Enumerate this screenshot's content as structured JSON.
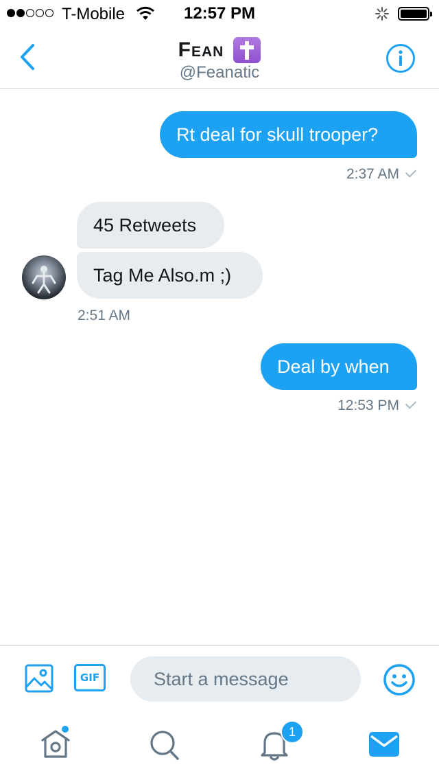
{
  "status_bar": {
    "carrier": "T-Mobile",
    "time": "12:57 PM",
    "signal_bars_filled": 2,
    "signal_bars_total": 5,
    "battery_level": 1.0,
    "icons": [
      "signal-dots-icon",
      "wifi-icon",
      "activity-spinner-icon",
      "battery-icon"
    ]
  },
  "header": {
    "name": "Fean",
    "name_emoji": "latin-cross-emoji",
    "handle": "@Feanatic",
    "icons": [
      "chevron-left-icon",
      "info-icon"
    ]
  },
  "conversation": {
    "messages": [
      {
        "direction": "outgoing",
        "text": "Rt deal for skull trooper?",
        "time": "2:37 AM",
        "read_check": true
      },
      {
        "direction": "incoming",
        "text": "45 Retweets"
      },
      {
        "direction": "incoming",
        "text": "Tag Me Also.m ;)",
        "time": "2:51 AM"
      },
      {
        "direction": "outgoing",
        "text": "Deal by when",
        "time": "12:53 PM",
        "read_check": true
      }
    ]
  },
  "composer": {
    "placeholder": "Start a message",
    "value": "",
    "gif_label": "GIF",
    "icons": [
      "image-icon",
      "gif-icon",
      "emoji-icon"
    ]
  },
  "tab_bar": {
    "tabs": [
      {
        "name": "home",
        "icon": "home-icon",
        "has_dot": true
      },
      {
        "name": "search",
        "icon": "search-icon"
      },
      {
        "name": "notifications",
        "icon": "bell-icon",
        "badge": "1"
      },
      {
        "name": "messages",
        "icon": "mail-icon",
        "active": true
      }
    ]
  },
  "colors": {
    "accent": "#1da1f2",
    "incoming_bubble": "#e6ecf0",
    "secondary_text": "#657786",
    "divider": "#d5d9dc"
  }
}
